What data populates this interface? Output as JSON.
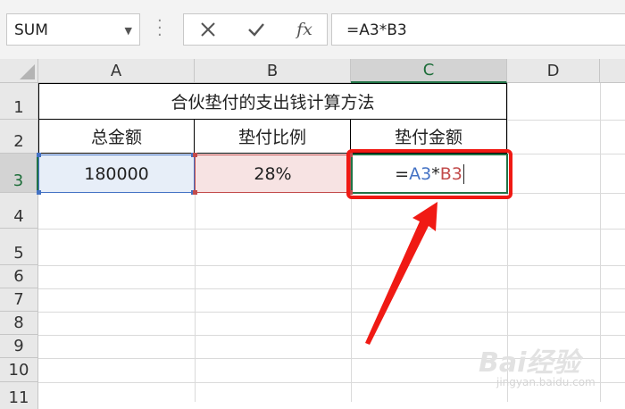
{
  "namebox": {
    "value": "SUM"
  },
  "formula_bar": {
    "value": "=A3*B3",
    "cancel_icon": "x-icon",
    "enter_icon": "check-icon",
    "fx_label": "fx"
  },
  "columns": [
    "A",
    "B",
    "C",
    "D"
  ],
  "rows": [
    "1",
    "2",
    "3",
    "4",
    "5",
    "6",
    "7",
    "8",
    "9",
    "10",
    "11"
  ],
  "cells": {
    "title": "合伙垫付的支出钱计算方法",
    "a2": "总金额",
    "b2": "垫付比例",
    "c2": "垫付金额",
    "a3": "180000",
    "b3": "28%",
    "c3": {
      "eq": "=",
      "ref1": "A3",
      "op": "*",
      "ref2": "B3"
    }
  },
  "colors": {
    "ref1": "#4472c4",
    "ref2": "#c24b4b",
    "selection": "#217346",
    "annotation": "#f01a14"
  },
  "watermark": {
    "main": "Bai经验",
    "sub": "jingyan.baidu.com"
  }
}
